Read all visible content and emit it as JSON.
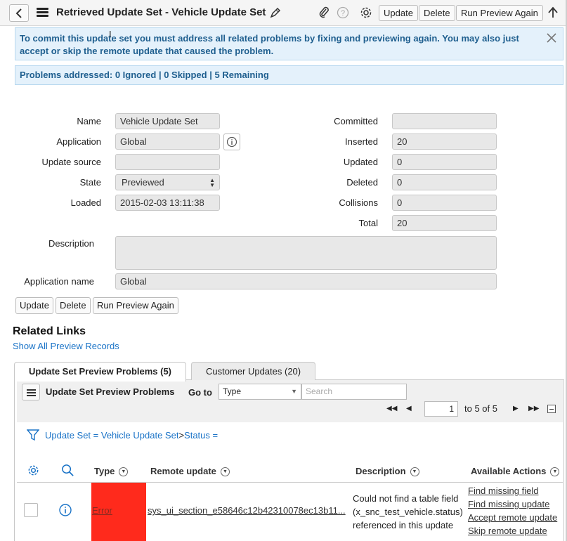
{
  "header": {
    "title": "Retrieved Update Set - Vehicle Update Set",
    "buttons": {
      "update": "Update",
      "delete": "Delete",
      "run_preview": "Run Preview Again"
    }
  },
  "alerts": {
    "commit_message": "To commit this update set you must address all related problems by fixing and previewing again. You may also just accept or skip the remote update that caused the problem.",
    "problems": "Problems addressed: 0 Ignored | 0 Skipped | 5 Remaining"
  },
  "form": {
    "labels": {
      "name": "Name",
      "application": "Application",
      "update_source": "Update source",
      "state": "State",
      "loaded": "Loaded",
      "description": "Description",
      "application_name": "Application name",
      "committed": "Committed",
      "inserted": "Inserted",
      "updated": "Updated",
      "deleted": "Deleted",
      "collisions": "Collisions",
      "total": "Total"
    },
    "values": {
      "name": "Vehicle Update Set",
      "application": "Global",
      "update_source": "",
      "state": "Previewed",
      "loaded": "2015-02-03 13:11:38",
      "description": "",
      "application_name": "Global",
      "committed": "",
      "inserted": "20",
      "updated": "0",
      "deleted": "0",
      "collisions": "0",
      "total": "20"
    },
    "buttons": {
      "update": "Update",
      "delete": "Delete",
      "run_preview": "Run Preview Again"
    }
  },
  "related_links": {
    "title": "Related Links",
    "show_all": "Show All Preview Records"
  },
  "tabs": [
    {
      "label": "Update Set Preview Problems (5)",
      "active": true
    },
    {
      "label": "Customer Updates (20)",
      "active": false
    }
  ],
  "list": {
    "title": "Update Set Preview Problems",
    "goto_label": "Go to",
    "goto_field": "Type",
    "search_placeholder": "Search",
    "page_value": "1",
    "page_of": "to 5 of 5",
    "breadcrumb": {
      "part1": "Update Set = Vehicle Update Set",
      "sep": ">",
      "part2": "Status ="
    },
    "columns": {
      "type": "Type",
      "remote_update": "Remote update",
      "description": "Description",
      "actions": "Available Actions"
    },
    "rows": [
      {
        "type": "Error",
        "remote_update": "sys_ui_section_e58646c12b42310078ec13b11...",
        "description": "Could not find a table field (x_snc_test_vehicle.status) referenced in this update",
        "actions": [
          "Find missing field",
          "Find missing update",
          "Accept remote update",
          "Skip remote update"
        ]
      }
    ]
  },
  "colors": {
    "accent_link": "#1a73c7",
    "alert_bg": "#e4f1fb",
    "error_cell": "#ff2a1c"
  }
}
